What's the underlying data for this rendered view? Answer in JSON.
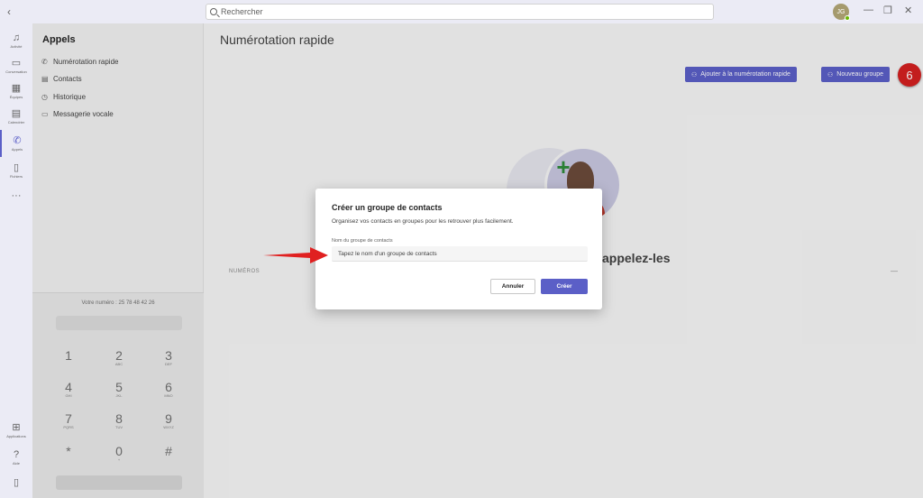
{
  "titlebar": {
    "search_placeholder": "Rechercher",
    "avatar_initials": "JG",
    "back_glyph": "‹",
    "minimize_glyph": "—",
    "maximize_glyph": "❐",
    "close_glyph": "✕"
  },
  "rail": {
    "items": [
      {
        "label": "Activité",
        "icon": "bell-icon",
        "glyph": "♫"
      },
      {
        "label": "Conversation",
        "icon": "chat-icon",
        "glyph": "▭"
      },
      {
        "label": "Équipes",
        "icon": "teams-icon",
        "glyph": "▦"
      },
      {
        "label": "Calendrier",
        "icon": "calendar-icon",
        "glyph": "▤"
      },
      {
        "label": "Appels",
        "icon": "phone-icon",
        "glyph": "✆"
      },
      {
        "label": "Fichiers",
        "icon": "file-icon",
        "glyph": "▯"
      },
      {
        "label": "",
        "icon": "more-icon",
        "glyph": "···"
      }
    ],
    "bottom": [
      {
        "label": "Applications",
        "icon": "apps-icon",
        "glyph": "⊞"
      },
      {
        "label": "Aide",
        "icon": "help-icon",
        "glyph": "?"
      },
      {
        "label": "",
        "icon": "device-icon",
        "glyph": "▯"
      }
    ]
  },
  "panel": {
    "title": "Appels",
    "items": [
      {
        "label": "Numérotation rapide",
        "icon": "speed-dial-icon",
        "glyph": "✆"
      },
      {
        "label": "Contacts",
        "icon": "contacts-icon",
        "glyph": "▤"
      },
      {
        "label": "Historique",
        "icon": "history-icon",
        "glyph": "◷"
      },
      {
        "label": "Messagerie vocale",
        "icon": "voicemail-icon",
        "glyph": "▭"
      }
    ],
    "dialpad": {
      "work_number": "Votre numéro : 25 78 48 42 26",
      "keys": [
        {
          "digit": "1",
          "sub": ""
        },
        {
          "digit": "2",
          "sub": "ABC"
        },
        {
          "digit": "3",
          "sub": "DEF"
        },
        {
          "digit": "4",
          "sub": "GHI"
        },
        {
          "digit": "5",
          "sub": "JKL"
        },
        {
          "digit": "6",
          "sub": "MNO"
        },
        {
          "digit": "7",
          "sub": "PQRS"
        },
        {
          "digit": "8",
          "sub": "TUV"
        },
        {
          "digit": "9",
          "sub": "WXYZ"
        },
        {
          "digit": "*",
          "sub": ""
        },
        {
          "digit": "0",
          "sub": "+"
        },
        {
          "digit": "#",
          "sub": ""
        }
      ]
    }
  },
  "main": {
    "title": "Numérotation rapide",
    "add_speed_dial_label": "Ajouter à la numérotation rapide",
    "new_group_label": "Nouveau groupe",
    "step_badge": "6",
    "tagline_fragment": "appelez-les",
    "section_label": "NUMÉROS",
    "dash": "—"
  },
  "dialog": {
    "title": "Créer un groupe de contacts",
    "description": "Organisez vos contacts en groupes pour les retrouver plus facilement.",
    "field_label": "Nom du groupe de contacts",
    "field_placeholder": "Tapez le nom d'un groupe de contacts",
    "field_value": "",
    "cancel_label": "Annuler",
    "create_label": "Créer"
  },
  "colors": {
    "accent": "#5b5fc7",
    "badge": "#d42020",
    "arrow": "#e02020"
  }
}
